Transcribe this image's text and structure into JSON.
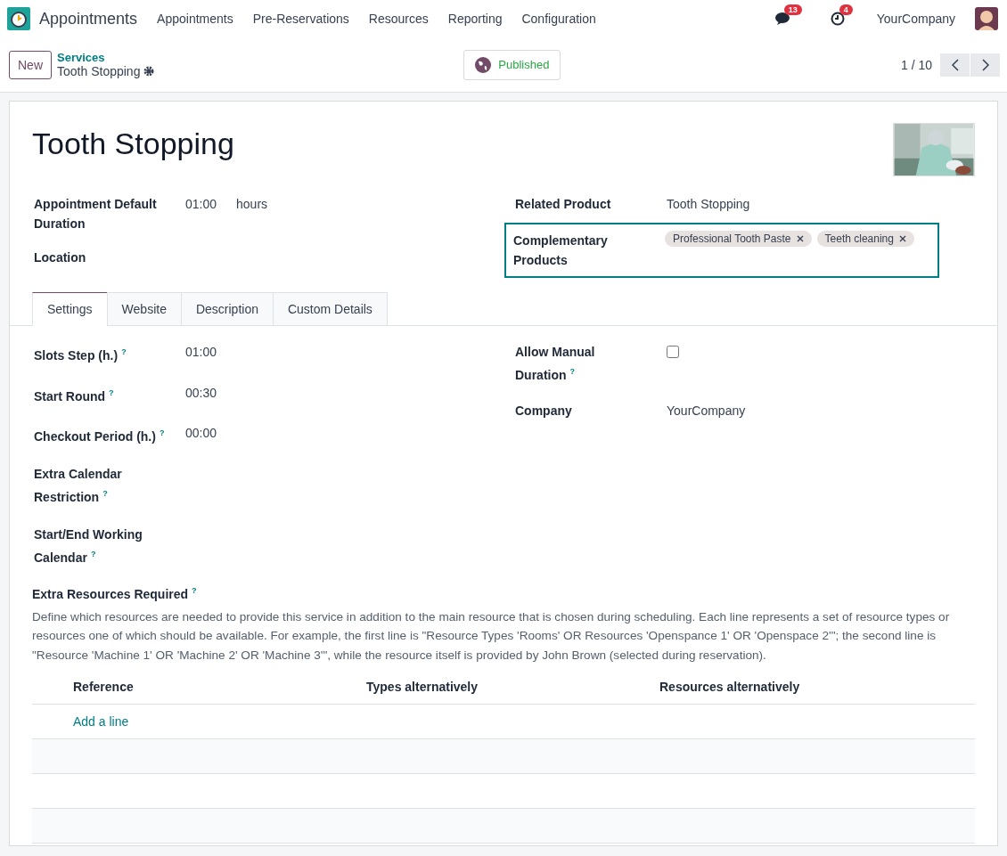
{
  "navbar": {
    "app_name": "Appointments",
    "menu": [
      "Appointments",
      "Pre-Reservations",
      "Resources",
      "Reporting",
      "Configuration"
    ],
    "messages_count": "13",
    "activities_count": "4",
    "company": "YourCompany"
  },
  "control_panel": {
    "new_button": "New",
    "breadcrumb": "Services",
    "record": "Tooth Stopping",
    "published_button": "Published",
    "pager": "1 / 10"
  },
  "form": {
    "title": "Tooth Stopping",
    "left_fields": [
      {
        "label": "Appointment Default Duration",
        "value": "01:00",
        "unit": "hours"
      },
      {
        "label": "Location"
      }
    ],
    "right_fields": [
      {
        "label": "Related Product",
        "value": "Tooth Stopping"
      }
    ],
    "complementary": {
      "label": "Complementary Products",
      "focused": true,
      "tags": [
        "Professional Tooth Paste",
        "Teeth cleaning"
      ]
    },
    "tabs": [
      {
        "label": "Settings",
        "selected": true
      },
      {
        "label": "Website",
        "selected": false
      },
      {
        "label": "Description",
        "selected": false
      },
      {
        "label": "Custom Details",
        "selected": false
      }
    ],
    "settings_left": [
      {
        "label": "Slots Step (h.)",
        "help": "?",
        "value": "01:00"
      },
      {
        "label": "Start Round",
        "help": "?",
        "value": "00:30"
      },
      {
        "label": "Checkout Period (h.)",
        "help": "?",
        "value": "00:00"
      },
      {
        "label": "Extra Calendar Restriction",
        "help": "?"
      },
      {
        "label": "Start/End Working Calendar",
        "help": "?"
      }
    ],
    "settings_right": [
      {
        "kind": "checkbox",
        "label": "Allow Manual Duration",
        "help": "?",
        "checked": false
      },
      {
        "kind": "text",
        "label": "Company",
        "value": "YourCompany"
      }
    ],
    "extra_resources": {
      "label": "Extra Resources Required",
      "help": "?",
      "description": "Define which resources are needed to provide this service in addition to the main resource that is chosen during scheduling. Each line represents a set of resource types or resources one of which should be available. For example, the first line is \"Resource Types 'Rooms' OR Resources 'Openspance 1' OR 'Openspace 2'\"; the second line is \"Resource 'Machine 1' OR 'Machine 2' OR 'Machine 3'\", while the resource itself is provided by John Brown (selected during reservation).",
      "columns": [
        "Reference",
        "Types alternatively",
        "Resources alternatively"
      ],
      "add_line": "Add a line"
    }
  }
}
